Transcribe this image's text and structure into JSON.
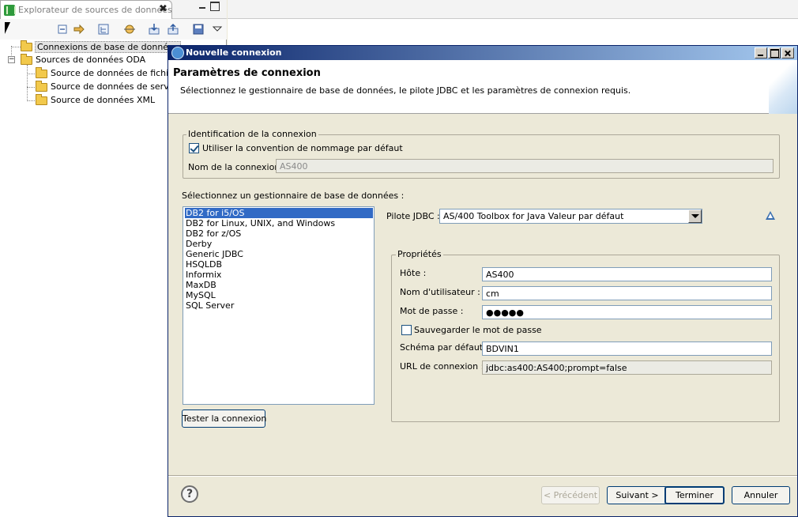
{
  "explorer": {
    "tab_title": "Explorateur de sources de données",
    "tree": [
      {
        "label": "Connexions de base de données",
        "selected": true
      },
      {
        "label": "Sources de données ODA"
      },
      {
        "label": "Source de données de fichier à"
      },
      {
        "label": "Source de données de services"
      },
      {
        "label": "Source de données XML"
      }
    ]
  },
  "dialog": {
    "title": "Nouvelle connexion",
    "header_title": "Paramètres de connexion",
    "header_desc": "Sélectionnez le gestionnaire de base de données, le pilote JDBC et les paramètres de connexion requis.",
    "identification": {
      "legend": "Identification de la connexion",
      "checkbox_label": "Utiliser la convention de nommage par défaut",
      "checked": true,
      "name_label": "Nom de la connexion :",
      "name_value": "AS400"
    },
    "db_manager_label": "Sélectionnez un gestionnaire de base de données :",
    "db_managers": [
      "DB2 for i5/OS",
      "DB2 for Linux, UNIX, and Windows",
      "DB2 for z/OS",
      "Derby",
      "Generic JDBC",
      "HSQLDB",
      "Informix",
      "MaxDB",
      "MySQL",
      "SQL Server"
    ],
    "selected_db_manager": "DB2 for i5/OS",
    "jdbc_label": "Pilote JDBC :",
    "jdbc_value": "AS/400 Toolbox for Java Valeur par défaut",
    "properties": {
      "legend": "Propriétés",
      "host_label": "Hôte :",
      "host_value": "AS400",
      "user_label": "Nom d'utilisateur :",
      "user_value": "cm",
      "password_label": "Mot de passe :",
      "password_value": "●●●●●",
      "save_password_label": "Sauvegarder le mot de passe",
      "save_password_checked": false,
      "schema_label": "Schéma par défaut :",
      "schema_value": "BDVIN1",
      "url_label": "URL de connexion :",
      "url_value": "jdbc:as400:AS400;prompt=false"
    },
    "test_button": "Tester la connexion",
    "buttons": {
      "back": "< Précédent",
      "next": "Suivant >",
      "finish": "Terminer",
      "cancel": "Annuler"
    }
  }
}
